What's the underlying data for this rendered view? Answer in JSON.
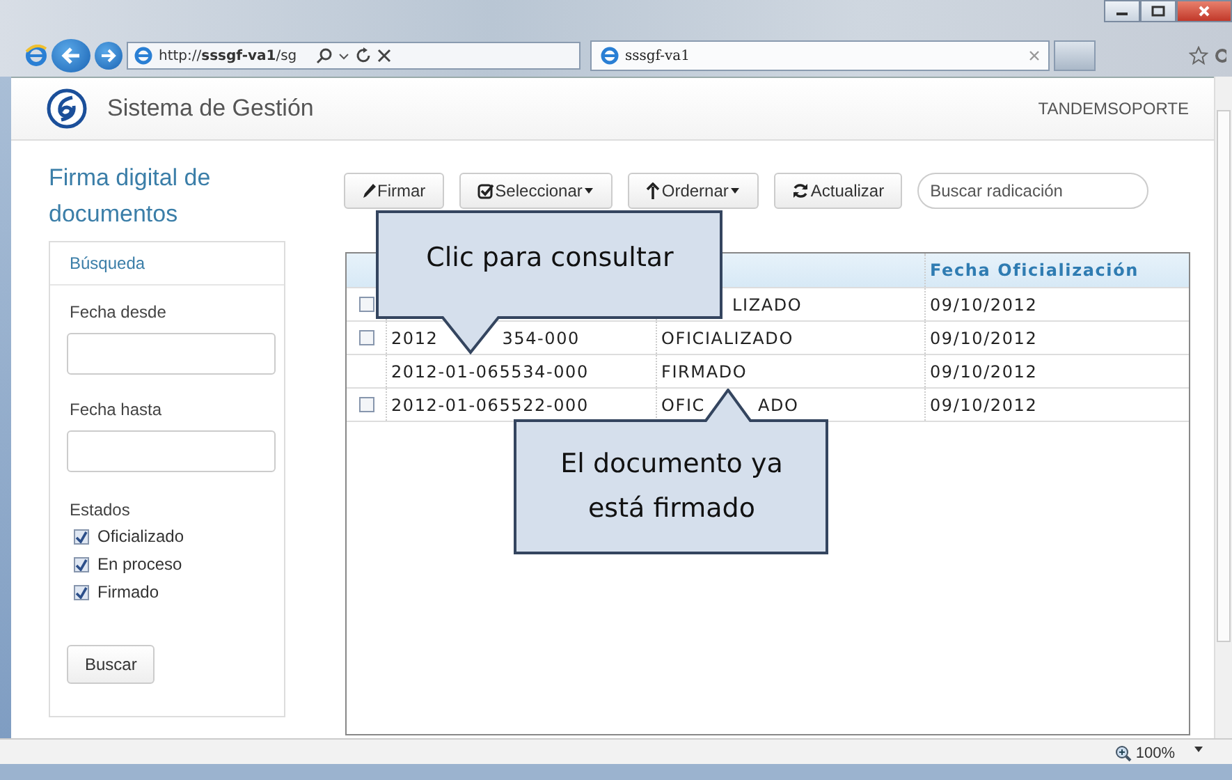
{
  "browser": {
    "address": "http://**sssgf-va1**/sg",
    "tab_title": "sssgf-va1",
    "zoom": "100%"
  },
  "app": {
    "title": "Sistema de Gestión",
    "user": "TANDEMSOPORTE"
  },
  "sidebar": {
    "heading": "Firma digital de documentos",
    "panel_title": "Búsqueda",
    "fields": [
      {
        "label": "Fecha desde"
      },
      {
        "label": "Fecha hasta"
      }
    ],
    "states_label": "Estados",
    "states": [
      {
        "label": "Oficializado",
        "checked": true
      },
      {
        "label": "En proceso",
        "checked": true
      },
      {
        "label": "Firmado",
        "checked": true
      }
    ],
    "button": "Buscar"
  },
  "toolbar": {
    "buttons": [
      {
        "kind": "pencil",
        "label": "Firmar",
        "dropdown": false
      },
      {
        "kind": "check",
        "label": "Seleccionar",
        "dropdown": true
      },
      {
        "kind": "arrow-up",
        "label": "Ordernar",
        "dropdown": true
      },
      {
        "kind": "refresh",
        "label": "Actualizar",
        "dropdown": false
      }
    ],
    "search": {
      "placeholder": "Buscar radicación"
    }
  },
  "table": {
    "column_3": "Fecha Oficialización",
    "rows": [
      {
        "selectable": true,
        "checked": false,
        "cells": [
          [],
          [
            "LIZADO"
          ],
          [
            "09/10/2012"
          ]
        ]
      },
      {
        "selectable": true,
        "checked": false,
        "cells": [
          [
            "2012",
            "354-000"
          ],
          [
            "OFICIALIZADO"
          ],
          [
            "09/10/2012"
          ]
        ]
      },
      {
        "selectable": false,
        "checked": false,
        "cells": [
          [
            "2012-01-065534-000"
          ],
          [
            "FIRMADO"
          ],
          [
            "09/10/2012"
          ]
        ]
      },
      {
        "selectable": true,
        "checked": false,
        "cells": [
          [
            "2012-01-065522-000"
          ],
          [
            "OFIC",
            "ADO"
          ],
          [
            "09/10/2012"
          ]
        ]
      }
    ]
  },
  "callouts": [
    {
      "text": "Clic para consultar"
    },
    {
      "text": "El documento ya está firmado"
    }
  ]
}
